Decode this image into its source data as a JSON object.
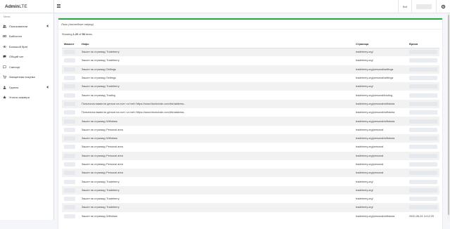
{
  "brand": {
    "bold": "Admin",
    "light": "LTE"
  },
  "topbar": {
    "link_label": "Bot",
    "user_icon": "blurred-user",
    "settings_icon": "gear-icon"
  },
  "sidebar": {
    "header": "Меню",
    "items": [
      {
        "label": "Пользователи",
        "icon": "users-icon",
        "has_children": true
      },
      {
        "label": "Бабоснон",
        "icon": "money-icon",
        "has_children": false
      },
      {
        "label": "Большой брат",
        "icon": "eye-icon",
        "has_children": false
      },
      {
        "label": "Общий чат",
        "icon": "chat-icon",
        "has_children": false
      },
      {
        "label": "Саппорт",
        "icon": "support-icon",
        "has_children": false
      },
      {
        "label": "Заещенная покупка",
        "icon": "cart-icon",
        "has_children": false
      },
      {
        "label": "Группы",
        "icon": "group-icon",
        "has_children": true
      },
      {
        "label": "Уголок скамера",
        "icon": "star-icon",
        "has_children": false
      }
    ]
  },
  "card": {
    "title": "Логи (последние сверху)",
    "summary": {
      "prefix": "Showing ",
      "range": "1-20",
      "mid": " of ",
      "total": "58",
      "suffix": " items."
    }
  },
  "table": {
    "columns": [
      "Мамонт",
      "Инфо",
      "Страница",
      "Время"
    ],
    "rows": [
      {
        "info": "Зашел на страницу Tradeberry",
        "page": "tradeberry.org/",
        "time": ""
      },
      {
        "info": "Зашел на страницу Tradeberry",
        "page": "tradeberry.org/",
        "time": ""
      },
      {
        "info": "Зашел на страницу Settings",
        "page": "tradeberry.org/personal/settings",
        "time": ""
      },
      {
        "info": "Зашел на страницу Settings",
        "page": "tradeberry.org/personal/settings",
        "time": ""
      },
      {
        "info": "Зашел на страницу Tradeberry",
        "page": "tradeberry.org/",
        "time": ""
      },
      {
        "info": "Зашел на страницу Trading",
        "page": "tradeberry.org/personal/trading",
        "time": ""
      },
      {
        "info": "Попытался вывести деньги на счет <a href='https://www.blockchain.com/btc/address...",
        "page": "tradeberry.org/personal/withdraw",
        "time": ""
      },
      {
        "info": "Попытался вывести деньги на счет <a href='https://www.blockchain.com/btc/address...",
        "page": "tradeberry.org/personal/withdraw",
        "time": ""
      },
      {
        "info": "Зашел на страницу Withdraw",
        "page": "tradeberry.org/personal/withdraw",
        "time": ""
      },
      {
        "info": "Зашел на страницу Personal area",
        "page": "tradeberry.org/personal",
        "time": ""
      },
      {
        "info": "Зашел на страницу Withdraw",
        "page": "tradeberry.org/personal/withdraw",
        "time": ""
      },
      {
        "info": "Зашел на страницу Personal area",
        "page": "tradeberry.org/personal",
        "time": ""
      },
      {
        "info": "Зашел на страницу Personal area",
        "page": "tradeberry.org/personal",
        "time": ""
      },
      {
        "info": "Зашел на страницу Personal area",
        "page": "tradeberry.org/personal",
        "time": ""
      },
      {
        "info": "Зашел на страницу Personal area",
        "page": "tradeberry.org/personal",
        "time": ""
      },
      {
        "info": "Зашел на страницу Tradeberry",
        "page": "tradeberry.org/",
        "time": ""
      },
      {
        "info": "Зашел на страницу Tradeberry",
        "page": "tradeberry.org/",
        "time": ""
      },
      {
        "info": "Зашел на страницу Tradeberry",
        "page": "tradeberry.org/",
        "time": ""
      },
      {
        "info": "Зашел на страницу Tradeberry",
        "page": "tradeberry.org/",
        "time": ""
      },
      {
        "info": "Зашел на страницу Withdraw",
        "page": "tradeberry.org/personal/withdraw",
        "time": "2020-06-24 14:12:20"
      }
    ]
  },
  "colors": {
    "accent": "#28a745",
    "row_stripe": "#f2f2f2"
  }
}
